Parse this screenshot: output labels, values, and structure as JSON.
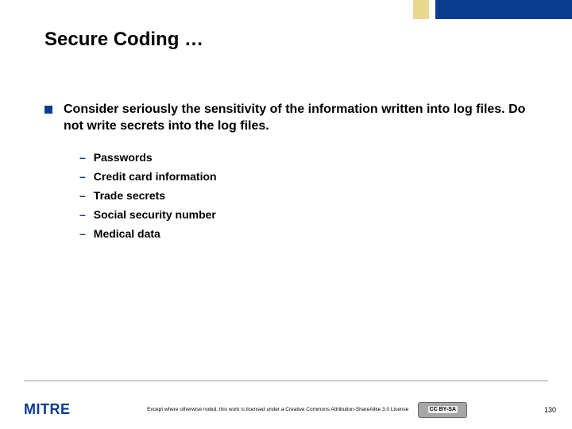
{
  "title": "Secure Coding …",
  "main_bullet": "Consider seriously the sensitivity of the information written into log files.  Do not write secrets into the log files.",
  "sub_bullets": [
    "Passwords",
    "Credit card information",
    "Trade secrets",
    "Social security number",
    "Medical data"
  ],
  "footer": {
    "logo": "MITRE",
    "license_text": "Except where otherwise noted, this work is licensed under a Creative Commons Attribution-ShareAlike 3.0 License",
    "cc_label": "CC BY-SA",
    "page_number": "130"
  },
  "colors": {
    "accent": "#0b3c8f",
    "tan": "#e8d890"
  }
}
